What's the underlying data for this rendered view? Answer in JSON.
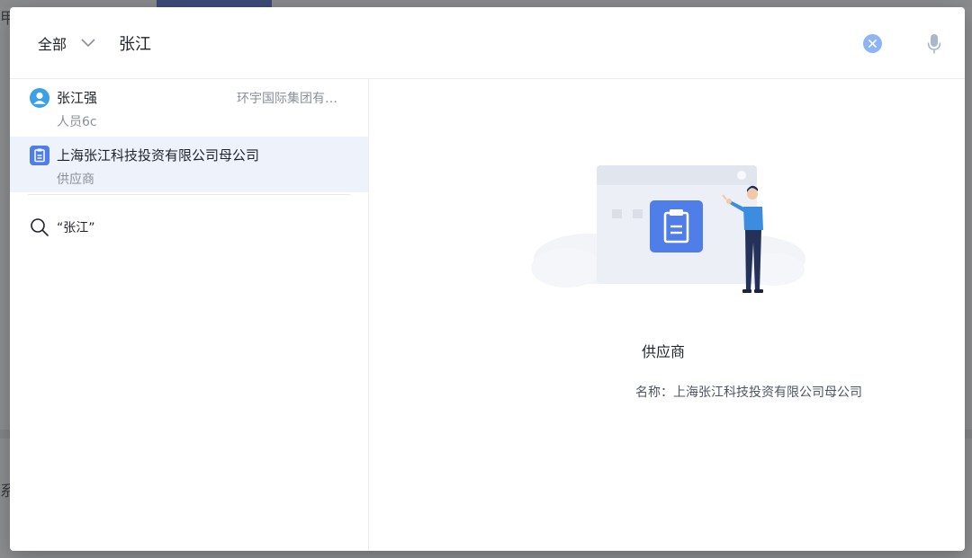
{
  "background": {
    "fragments": [
      "甲",
      "系"
    ]
  },
  "search": {
    "scope_label": "全部",
    "query": "张江",
    "clear_label": "×"
  },
  "results": [
    {
      "title": "张江强",
      "subtitle": "人员6c",
      "meta": "环宇国际集团有限公司",
      "icon": "person-icon",
      "icon_color": "#3aa0e8"
    },
    {
      "title": "上海张江科技投资有限公司母公司",
      "subtitle": "供应商",
      "icon": "clipboard-icon",
      "icon_color": "#4f7ee8"
    }
  ],
  "suggestion": {
    "text": "“张江”"
  },
  "detail": {
    "category": "供应商",
    "name_label": "名称：",
    "name_value": "上海张江科技投资有限公司母公司"
  },
  "colors": {
    "accent": "#4f7ee8",
    "selected_row": "#eef2fb",
    "clear_button": "#8fb3f5"
  }
}
